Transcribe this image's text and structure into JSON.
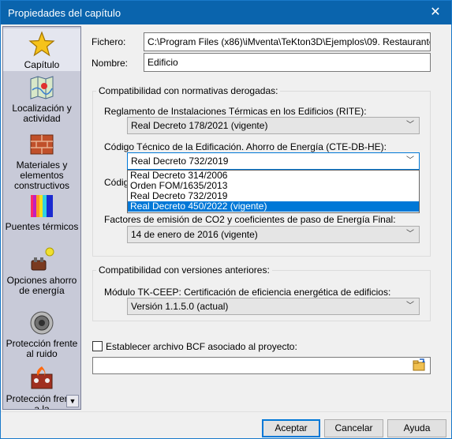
{
  "window": {
    "title": "Propiedades del capítulo",
    "close_glyph": "✕"
  },
  "sidebar": {
    "items": [
      {
        "label": "Capítulo",
        "icon": "star-icon"
      },
      {
        "label": "Localización y actividad",
        "icon": "map-icon"
      },
      {
        "label": "Materiales y elementos constructivos",
        "icon": "brick-icon"
      },
      {
        "label": "Puentes térmicos",
        "icon": "thermal-bridge-icon"
      },
      {
        "label": "Opciones ahorro de energía",
        "icon": "energy-saving-icon"
      },
      {
        "label": "Protección frente al ruido",
        "icon": "speaker-icon"
      },
      {
        "label": "Protección frente a la",
        "icon": "fire-protection-icon"
      }
    ],
    "scroll_glyph": "▼"
  },
  "form": {
    "fichero_label": "Fichero:",
    "fichero_value": "C:\\Program Files (x86)\\iMventa\\TeKton3D\\Ejemplos\\09. Restaurante\\Ejem",
    "nombre_label": "Nombre:",
    "nombre_value": "Edificio"
  },
  "normativas": {
    "group_title": "Compatibilidad con normativas derogadas:",
    "rite_label": "Reglamento de Instalaciones Térmicas en los Edificios (RITE):",
    "rite_value": "Real Decreto 178/2021 (vigente)",
    "cte_label": "Código Técnico de la Edificación. Ahorro de Energía (CTE-DB-HE):",
    "cte_value": "Real Decreto 732/2019",
    "cte_options": [
      "Real Decreto 314/2006",
      "Orden FOM/1635/2013",
      "Real Decreto 732/2019",
      "Real Decreto 450/2022 (vigente)"
    ],
    "cte_selected_index": 3,
    "hidden_label_fragment": "Códig",
    "factores_label": "Factores de emisión de CO2 y coeficientes de paso de Energía Final:",
    "factores_value": "14 de enero de 2016 (vigente)"
  },
  "versiones": {
    "group_title": "Compatibilidad con versiones anteriores:",
    "modulo_label": "Módulo TK-CEEP: Certificación de eficiencia energética de edificios:",
    "modulo_value": "Versión 1.1.5.0 (actual)"
  },
  "bcf": {
    "checkbox_label": "Establecer archivo BCF asociado al proyecto:",
    "checked": false,
    "path_value": "",
    "browse_icon": "folder-open-icon"
  },
  "buttons": {
    "accept": "Aceptar",
    "cancel": "Cancelar",
    "help": "Ayuda"
  },
  "colors": {
    "titlebar": "#0a64ad",
    "selection": "#0078d7",
    "sidebar_bg": "#c8cad8"
  },
  "dropdown_arrow": "﹀"
}
